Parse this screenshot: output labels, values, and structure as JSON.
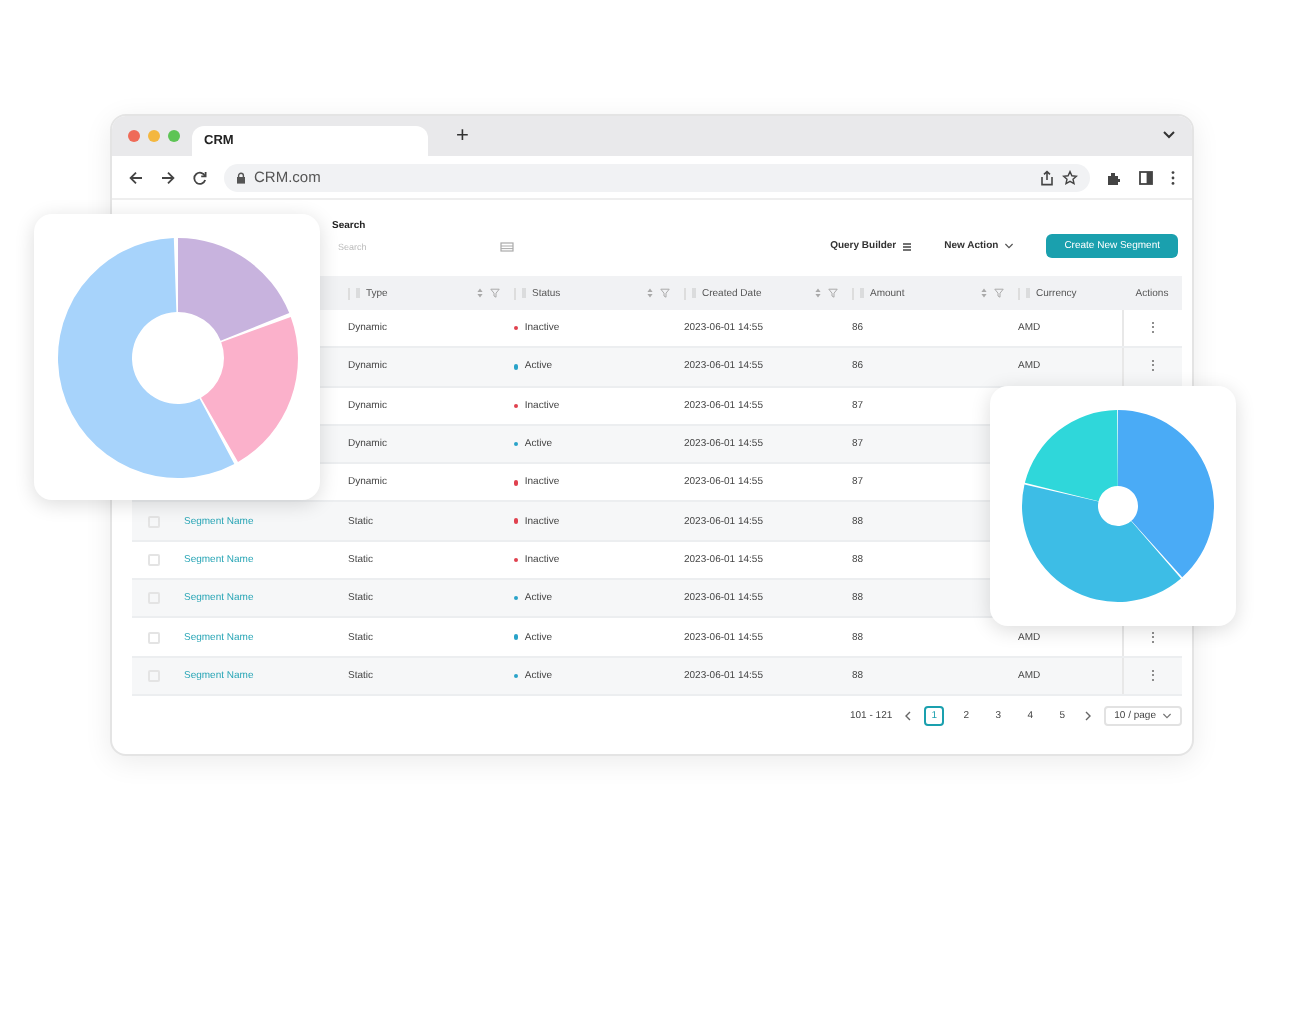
{
  "browser": {
    "tab_title": "CRM",
    "new_tab": "+",
    "url": "CRM.com"
  },
  "toolbar": {
    "search_label": "Search",
    "search_placeholder": "Search",
    "query_builder": "Query Builder",
    "new_action": "New Action",
    "create_button": "Create New Segment"
  },
  "table": {
    "columns": [
      {
        "label": "Type",
        "sortable": true
      },
      {
        "label": "Status",
        "sortable": true
      },
      {
        "label": "Created Date",
        "sortable": true
      },
      {
        "label": "Amount",
        "sortable": true
      },
      {
        "label": "Currency",
        "sortable": false
      },
      {
        "label": "Actions",
        "sortable": false
      }
    ],
    "rows": [
      {
        "type": "Dynamic",
        "status": "Inactive",
        "color": "#e0414f",
        "created": "2023-06-01 14:55",
        "amount": "86",
        "currency": "AMD",
        "actions": "⋮"
      },
      {
        "type": "Dynamic",
        "status": "Active",
        "color": "#2aa3c9",
        "created": "2023-06-01 14:55",
        "amount": "86",
        "currency": "AMD",
        "actions": "⋮"
      },
      {
        "type": "Dynamic",
        "status": "Inactive",
        "color": "#e0414f",
        "created": "2023-06-01 14:55",
        "amount": "87"
      },
      {
        "type": "Dynamic",
        "status": "Active",
        "color": "#2aa3c9",
        "created": "2023-06-01 14:55",
        "amount": "87"
      },
      {
        "type": "Dynamic",
        "status": "Inactive",
        "color": "#e0414f",
        "created": "2023-06-01 14:55",
        "amount": "87"
      },
      {
        "checked": false,
        "name": "Segment Name",
        "type": "Static",
        "status": "Inactive",
        "color": "#e0414f",
        "created": "2023-06-01 14:55",
        "amount": "88"
      },
      {
        "checked": false,
        "name": "Segment Name",
        "type": "Static",
        "status": "Inactive",
        "color": "#e0414f",
        "created": "2023-06-01 14:55",
        "amount": "88"
      },
      {
        "checked": false,
        "name": "Segment Name",
        "type": "Static",
        "status": "Active",
        "color": "#2aa3c9",
        "created": "2023-06-01 14:55",
        "amount": "88"
      },
      {
        "checked": false,
        "name": "Segment Name",
        "type": "Static",
        "status": "Active",
        "color": "#2aa3c9",
        "created": "2023-06-01 14:55",
        "amount": "88",
        "currency": "AMD",
        "actions": "⋮"
      },
      {
        "checked": false,
        "name": "Segment Name",
        "type": "Static",
        "status": "Active",
        "color": "#2aa3c9",
        "created": "2023-06-01 14:55",
        "amount": "88",
        "currency": "AMD",
        "actions": "⋮"
      }
    ]
  },
  "pagination": {
    "range": "101 - 121",
    "pages": [
      {
        "label": "1",
        "selected": true
      },
      {
        "label": "2",
        "selected": false
      },
      {
        "label": "3",
        "selected": false
      },
      {
        "label": "4",
        "selected": false
      },
      {
        "label": "5",
        "selected": false
      }
    ],
    "page_size": "10 / page"
  }
}
